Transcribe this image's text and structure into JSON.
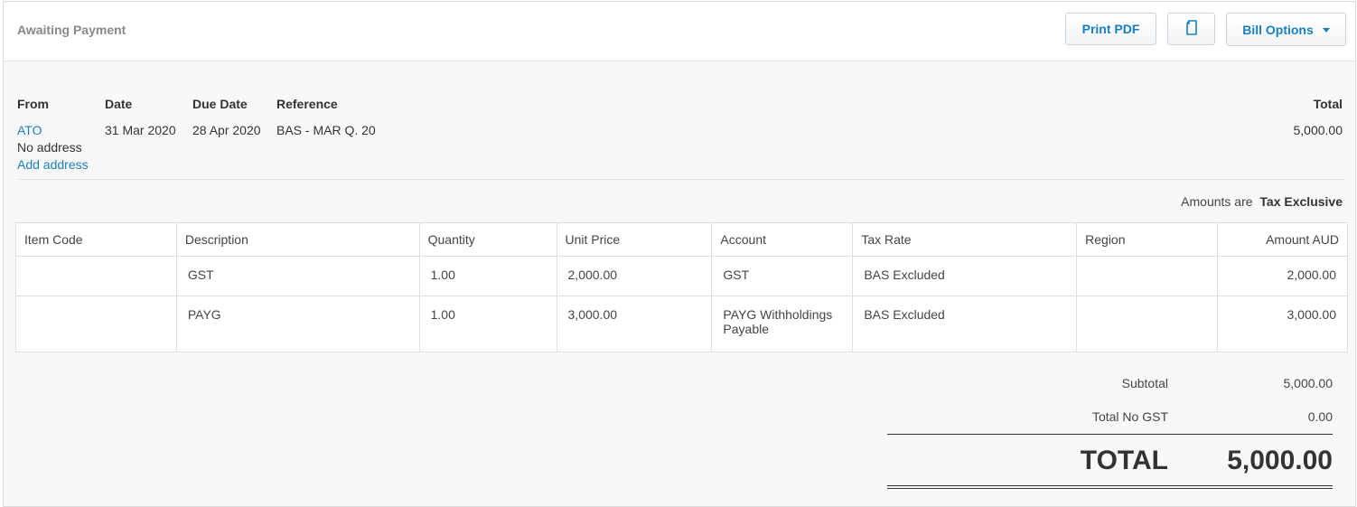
{
  "header": {
    "status": "Awaiting Payment",
    "print_pdf": "Print PDF",
    "bill_options": "Bill Options",
    "copy_icon": "document-copy-icon"
  },
  "bill": {
    "from_label": "From",
    "date_label": "Date",
    "due_date_label": "Due Date",
    "reference_label": "Reference",
    "total_label": "Total",
    "from": "ATO",
    "address": "No address",
    "add_address": "Add address",
    "date": "31 Mar 2020",
    "due_date": "28 Apr 2020",
    "reference": "BAS - MAR Q. 20",
    "total": "5,000.00"
  },
  "amounts_are": {
    "label": "Amounts are",
    "value": "Tax Exclusive"
  },
  "table": {
    "columns": [
      "Item Code",
      "Description",
      "Quantity",
      "Unit Price",
      "Account",
      "Tax Rate",
      "Region",
      "Amount AUD"
    ],
    "rows": [
      {
        "item_code": "",
        "description": "GST",
        "quantity": "1.00",
        "unit_price": "2,000.00",
        "account": "GST",
        "tax_rate": "BAS Excluded",
        "region": "",
        "amount": "2,000.00"
      },
      {
        "item_code": "",
        "description": "PAYG",
        "quantity": "1.00",
        "unit_price": "3,000.00",
        "account": "PAYG Withholdings Payable",
        "tax_rate": "BAS Excluded",
        "region": "",
        "amount": "3,000.00"
      }
    ]
  },
  "summary": {
    "subtotal_label": "Subtotal",
    "subtotal": "5,000.00",
    "no_gst_label": "Total No GST",
    "no_gst": "0.00",
    "total_label": "TOTAL",
    "total": "5,000.00"
  },
  "colors": {
    "link": "#1a7fbf",
    "background": "#f8f8f8"
  }
}
